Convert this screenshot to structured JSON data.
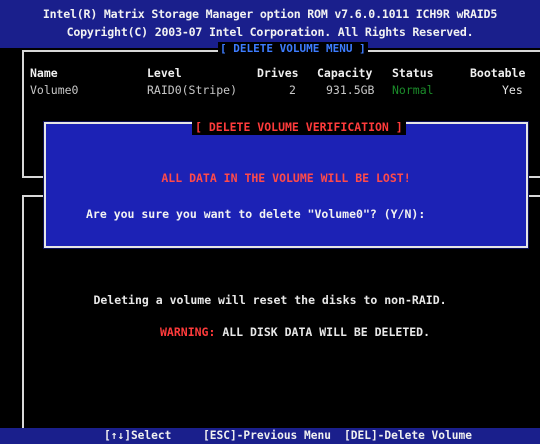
{
  "header": {
    "line1": "Intel(R) Matrix Storage Manager option ROM v7.6.0.1011 ICH9R wRAID5",
    "line2": "Copyright(C) 2003-07 Intel Corporation.  All Rights Reserved."
  },
  "delete_menu": {
    "title": "[ DELETE VOLUME MENU ]",
    "columns": [
      "Name",
      "Level",
      "Drives",
      "Capacity",
      "Status",
      "Bootable"
    ],
    "rows": [
      {
        "name": "Volume0",
        "level": "RAID0(Stripe)",
        "drives": "2",
        "capacity": "931.5GB",
        "status": "Normal",
        "bootable": "Yes"
      }
    ]
  },
  "verification_dialog": {
    "title": "[ DELETE VOLUME VERIFICATION ]",
    "warning": "ALL DATA IN THE VOLUME WILL BE LOST!",
    "question": "Are you sure you want to delete \"Volume0\"? (Y/N):"
  },
  "info": {
    "line1": "Deleting a volume will reset the disks to non-RAID.",
    "warning_label": "WARNING:",
    "warning_text": " ALL DISK DATA WILL BE DELETED."
  },
  "footer": {
    "select": "[↑↓]Select",
    "previous": "[ESC]-Previous Menu",
    "delete": "[DEL]-Delete Volume"
  },
  "colors": {
    "bar_blue": "#1a1f8c",
    "dialog_blue": "#1c22b5",
    "warning_red": "#ff3b3b",
    "status_green": "#1b8c2a",
    "menu_title_blue": "#3d7cff"
  }
}
